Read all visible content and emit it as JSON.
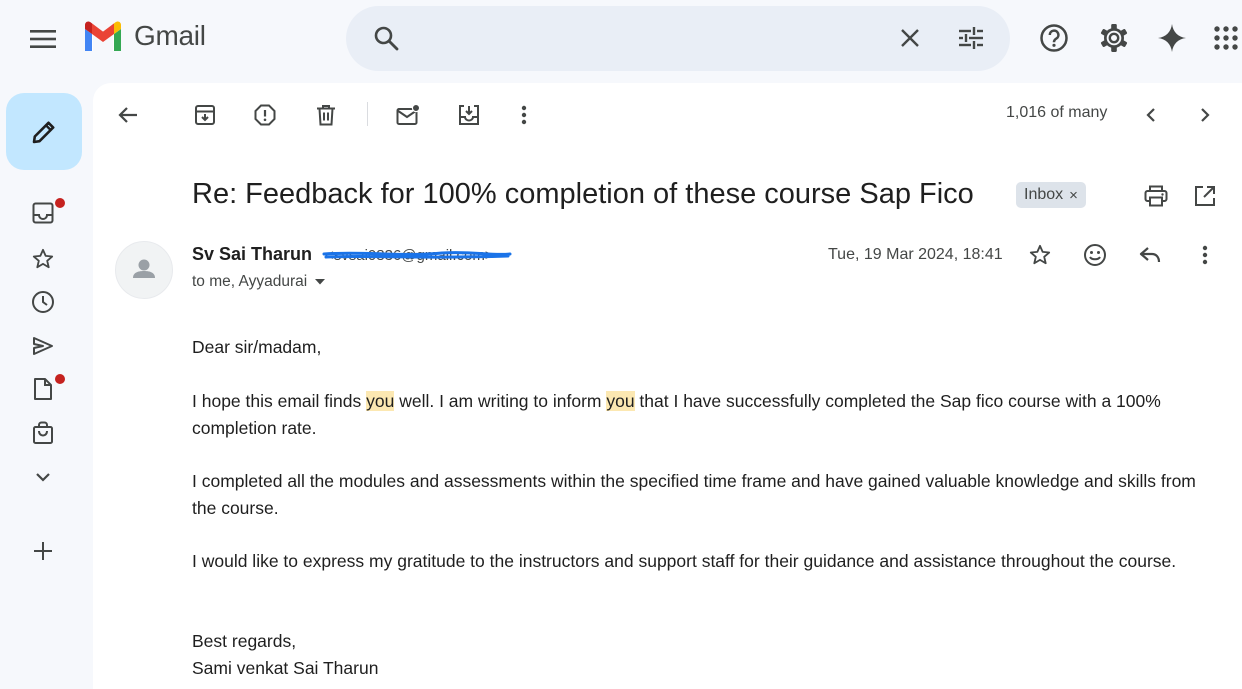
{
  "app": {
    "name": "Gmail"
  },
  "search": {
    "placeholder": ""
  },
  "toolbar": {
    "count": "1,016 of many"
  },
  "email": {
    "subject": "Re: Feedback for 100% completion of these course Sap Fico",
    "label": "Inbox",
    "label_close": "×",
    "sender_name": "Sv Sai Tharun",
    "sender_email": "<svsai0836@gmail.com>",
    "recipients": "to me, Ayyadurai",
    "date": "Tue, 19 Mar 2024, 18:41",
    "greeting": "Dear sir/madam,",
    "p1_a": "I hope this email finds ",
    "p1_hl1": "you",
    "p1_b": " well. I am writing to inform ",
    "p1_hl2": "you",
    "p1_c": " that I have successfully completed the Sap fico course with a 100% completion rate.",
    "p2": "I completed all the modules and assessments within the specified time frame and have gained valuable knowledge and skills from the course.",
    "p3": "I would like to express my gratitude to the instructors and support staff for their guidance and assistance throughout the course.",
    "signoff": "Best regards,",
    "signature": "Sami venkat Sai Tharun"
  },
  "colors": {
    "compose_bg": "#c2e7ff",
    "highlight": "#fce8b2",
    "redaction": "#1a73e8",
    "notification_dot": "#c5221f"
  },
  "icons": [
    "menu-icon",
    "gmail-logo",
    "search-icon",
    "clear-search-icon",
    "search-options-icon",
    "help-icon",
    "settings-icon",
    "gemini-icon",
    "apps-icon",
    "compose-pencil-icon",
    "inbox-icon",
    "star-icon",
    "snoozed-icon",
    "sent-icon",
    "drafts-icon",
    "purchases-icon",
    "more-chevron-icon",
    "add-label-icon",
    "back-arrow-icon",
    "archive-icon",
    "report-spam-icon",
    "delete-icon",
    "mark-unread-icon",
    "move-to-icon",
    "more-vert-icon",
    "prev-icon",
    "next-icon",
    "print-icon",
    "open-new-window-icon",
    "avatar-person-icon",
    "dropdown-arrow-icon",
    "emoji-icon",
    "reply-icon"
  ]
}
